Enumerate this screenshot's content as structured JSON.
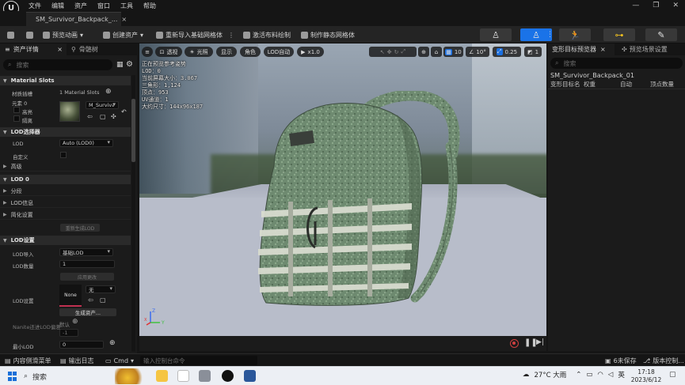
{
  "menu": [
    "文件",
    "编辑",
    "资产",
    "窗口",
    "工具",
    "帮助"
  ],
  "window_controls": [
    "—",
    "❐",
    "✕"
  ],
  "document_tab": {
    "label": "SM_Survivor_Backpack_...",
    "close": "×"
  },
  "toolbar": {
    "preview_anim": "预览动画",
    "create_asset": "创建资产",
    "reimport": "重新导入基础网格体",
    "activate_cloth": "激活布料绘制",
    "make_static": "制作静态网格体"
  },
  "left_panel": {
    "tab_details": "资产详情",
    "tab_skeleton": "骨骼树",
    "search_placeholder": "搜索",
    "material_slots": {
      "section": "Material Slots",
      "label": "材质插槽",
      "count": "1 Material Slots",
      "element_label": "元素 0",
      "material_name": "M_Survival_Ba",
      "highlight": "高亮",
      "isolate": "隔离"
    },
    "lod_picker": {
      "section": "LOD选择器",
      "lod_label": "LOD",
      "lod_value": "Auto (LOD0)",
      "custom_label": "自定义",
      "advanced": "高级"
    },
    "lod0": {
      "section": "LOD 0",
      "sub1": "分段",
      "sub2": "LOD信息",
      "sub3": "简化设置",
      "apply_btn": "重新生成LOD"
    },
    "lod_settings": {
      "section": "LOD设置",
      "import_label": "LOD导入",
      "import_value": "基础LOD",
      "count_label": "LOD数量",
      "count_value": "1",
      "apply_btn": "应用更改",
      "settings_label": "LOD设置",
      "none_thumb": "None",
      "none_value": "无",
      "generate_btn": "生成资产...",
      "nanite_label": "Nanite还进LOD偏差",
      "default_label": "默认",
      "default_value": "-1",
      "min_lod_label": "最小LOD",
      "min_lod_value": "0"
    }
  },
  "viewport": {
    "btn_perspective": "透视",
    "btn_lit": "光照",
    "btn_show": "显示",
    "btn_character": "角色",
    "btn_lod": "LOD自动",
    "btn_speed": "x1.0",
    "grid": "10",
    "angle": "10°",
    "scale": "0.25",
    "camera": "1",
    "stats": [
      "正在预览参考姿势",
      "LOD：0",
      "当前屏幕大小：3.067",
      "三角形：1,124",
      "顶点：953",
      "UV通道：1",
      "大约尺寸：144x96x187"
    ],
    "axis_z": "Z",
    "axis_y": "Y",
    "axis_x": "X"
  },
  "right_panel": {
    "tab_morph": "变形目标预览器",
    "tab_scene": "预览场景设置",
    "search_placeholder": "搜索",
    "asset_name": "SM_Survivor_Backpack_01",
    "columns": [
      "变形目标名",
      "权重",
      "自动",
      "顶点数量"
    ]
  },
  "statusbar": {
    "content_drawer": "内容侧滑菜单",
    "output_log": "输出日志",
    "cmd": "Cmd",
    "cmd_placeholder": "输入控制台命令",
    "unsaved": "6未保存",
    "source_control": "版本控制..."
  },
  "taskbar": {
    "search": "搜索",
    "weather": "27°C 大雨",
    "ime": "英",
    "time": "17:18",
    "date": "2023/6/12"
  },
  "colors": {
    "accent": "#1a73e8",
    "backpack": "#6e8a70",
    "panel": "#1b1b1b"
  }
}
